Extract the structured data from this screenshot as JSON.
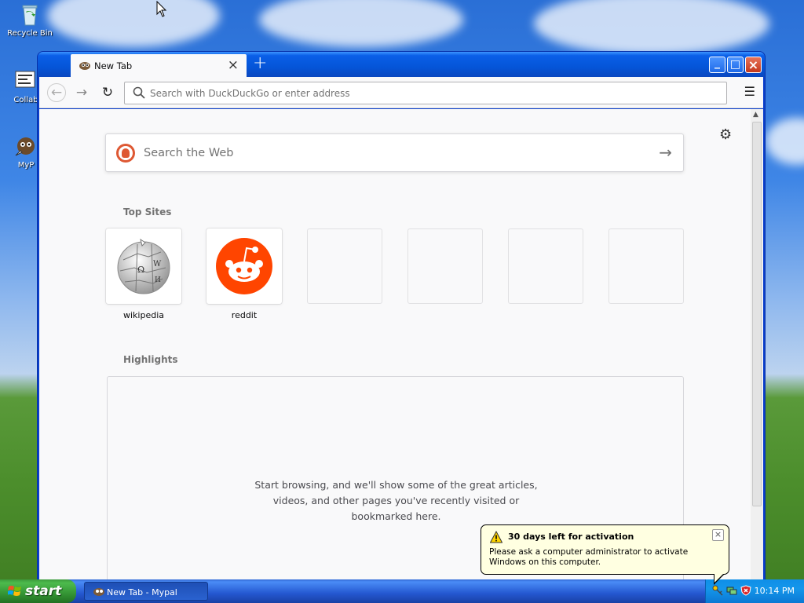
{
  "desktop": {
    "icons": [
      {
        "label": "Recycle Bin"
      },
      {
        "label": "Collab"
      },
      {
        "label": "MyP"
      }
    ]
  },
  "window": {
    "tab": {
      "title": "New Tab",
      "close": "×"
    },
    "new_tab_symbol": "+",
    "controls": {
      "minimize": "_",
      "maximize": "□",
      "close": "×"
    }
  },
  "toolbar": {
    "back": "←",
    "forward": "→",
    "reload": "↻",
    "url_placeholder": "Search with DuckDuckGo or enter address",
    "menu": "☰"
  },
  "newtab": {
    "settings": "⚙",
    "search_placeholder": "Search the Web",
    "search_go": "→",
    "top_sites_title": "Top Sites",
    "top_sites": [
      {
        "label": "wikipedia"
      },
      {
        "label": "reddit"
      }
    ],
    "highlights_title": "Highlights",
    "highlights_empty": "Start browsing, and we'll show some of the great articles, videos, and other pages you've recently visited or bookmarked here."
  },
  "balloon": {
    "title": "30 days left for activation",
    "message": "Please ask a computer administrator to activate Windows on this computer.",
    "close": "×"
  },
  "taskbar": {
    "start_label": "start",
    "task_label": "New Tab - Mypal",
    "clock": "10:14 PM"
  },
  "colors": {
    "titlebar": "#0555d8",
    "reddit_orange": "#ff4500",
    "ddg_orange": "#de5833",
    "start_green": "#3c9b3c"
  }
}
